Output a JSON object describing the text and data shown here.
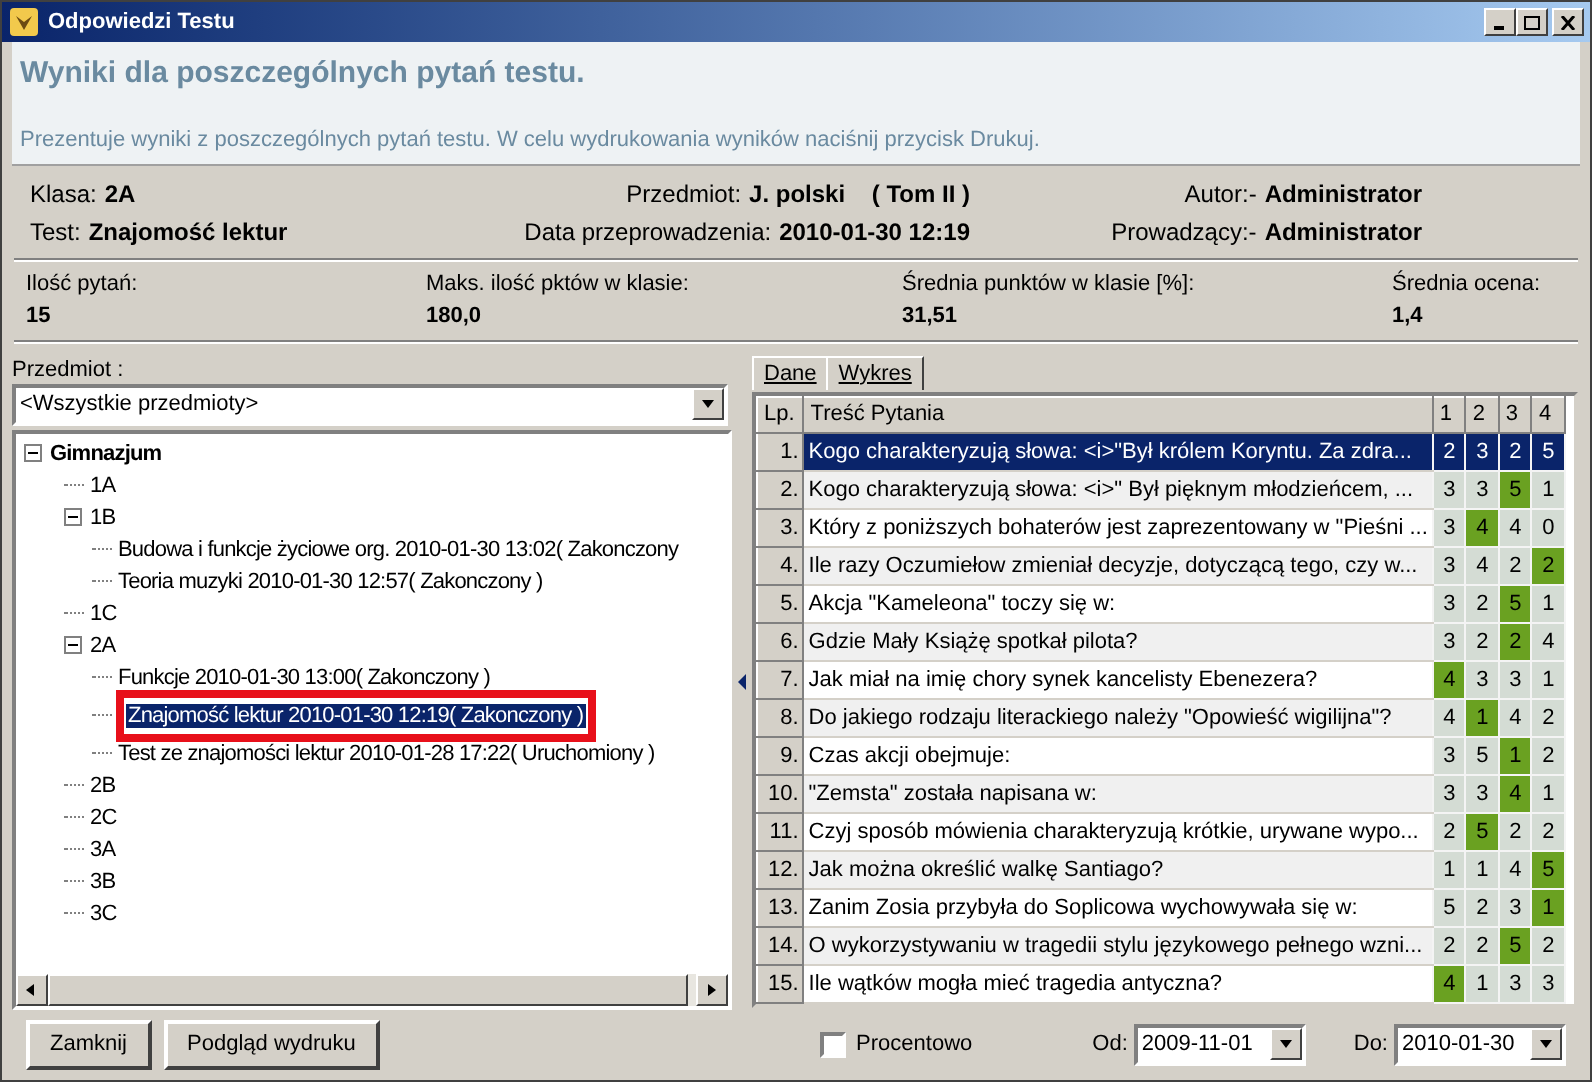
{
  "window": {
    "title": "Odpowiedzi Testu"
  },
  "header": {
    "title": "Wyniki dla poszczególnych pytań testu.",
    "description": "Prezentuje wyniki z poszczególnych pytań testu. W celu wydrukowania wyników naciśnij przycisk Drukuj."
  },
  "info": [
    {
      "label": "Klasa:",
      "value": "2A"
    },
    {
      "label": "Przedmiot:",
      "value": "J. polski    ( Tom II )"
    },
    {
      "label": "Autor:-",
      "value": "Administrator"
    },
    {
      "label": "Test:",
      "value": "Znajomość lektur"
    },
    {
      "label": "Data przeprowadzenia:",
      "value": "2010-01-30 12:19"
    },
    {
      "label": "Prowadzący:-",
      "value": "Administrator"
    }
  ],
  "stats": [
    {
      "label": "Ilość pytań:",
      "value": "15"
    },
    {
      "label": "Maks. ilość pktów w klasie:",
      "value": "180,0"
    },
    {
      "label": "Średnia punktów w klasie [%]:",
      "value": "31,51"
    },
    {
      "label": "Średnia ocena:",
      "value": "1,4"
    }
  ],
  "subject": {
    "label": "Przedmiot :",
    "value": "<Wszystkie przedmioty>"
  },
  "tree": [
    {
      "label": "Gimnazjum",
      "expanded": true,
      "selected": false,
      "children": [
        {
          "label": "1A",
          "selected": false
        },
        {
          "label": "1B",
          "expanded": true,
          "selected": false,
          "children": [
            {
              "label": "Budowa i funkcje życiowe org. 2010-01-30 13:02( Zakonczony",
              "selected": false
            },
            {
              "label": "Teoria muzyki 2010-01-30 12:57( Zakonczony )",
              "selected": false
            }
          ]
        },
        {
          "label": "1C",
          "selected": false
        },
        {
          "label": "2A",
          "expanded": true,
          "selected": false,
          "children": [
            {
              "label": "Funkcje 2010-01-30 13:00( Zakonczony )",
              "selected": false
            },
            {
              "label": "Znajomość lektur 2010-01-30 12:19( Zakonczony )",
              "selected": true,
              "highlighted": true
            },
            {
              "label": "Test ze znajomości lektur 2010-01-28 17:22( Uruchomiony )",
              "selected": false
            }
          ]
        },
        {
          "label": "2B",
          "selected": false
        },
        {
          "label": "2C",
          "selected": false
        },
        {
          "label": "3A",
          "selected": false
        },
        {
          "label": "3B",
          "selected": false
        },
        {
          "label": "3C",
          "selected": false
        }
      ]
    }
  ],
  "tabs": [
    {
      "label": "Dane",
      "selected": true
    },
    {
      "label": "Wykres",
      "selected": false
    }
  ],
  "table": {
    "columns": [
      "Lp.",
      "Treść Pytania",
      "1",
      "2",
      "3",
      "4"
    ],
    "rows": [
      {
        "lp": "1.",
        "question": "Kogo charakteryzują słowa: <i>\"Był królem Koryntu. Za zdra...",
        "selected": true,
        "answers": [
          {
            "value": "2"
          },
          {
            "value": "3"
          },
          {
            "value": "2"
          },
          {
            "value": "5"
          }
        ]
      },
      {
        "lp": "2.",
        "question": "Kogo charakteryzują słowa: <i>\" Był pięknym młodzieńcem, ...",
        "selected": false,
        "answers": [
          {
            "value": "3",
            "correct": false
          },
          {
            "value": "3",
            "correct": false
          },
          {
            "value": "5",
            "correct": true
          },
          {
            "value": "1",
            "correct": false
          }
        ]
      },
      {
        "lp": "3.",
        "question": "Który z poniższych bohaterów jest zaprezentowany w \"Pieśni ...",
        "selected": false,
        "answers": [
          {
            "value": "3",
            "correct": false
          },
          {
            "value": "4",
            "correct": true
          },
          {
            "value": "4",
            "correct": false
          },
          {
            "value": "0",
            "correct": false
          }
        ]
      },
      {
        "lp": "4.",
        "question": "Ile razy Oczumiełow zmieniał decyzje, dotyczącą tego, czy w...",
        "selected": false,
        "answers": [
          {
            "value": "3",
            "correct": false
          },
          {
            "value": "4",
            "correct": false
          },
          {
            "value": "2",
            "correct": false
          },
          {
            "value": "2",
            "correct": true
          }
        ]
      },
      {
        "lp": "5.",
        "question": "Akcja \"Kameleona\" toczy się w:",
        "selected": false,
        "answers": [
          {
            "value": "3",
            "correct": false
          },
          {
            "value": "2",
            "correct": false
          },
          {
            "value": "5",
            "correct": true
          },
          {
            "value": "1",
            "correct": false
          }
        ]
      },
      {
        "lp": "6.",
        "question": "Gdzie Mały Książę spotkał pilota?",
        "selected": false,
        "answers": [
          {
            "value": "3",
            "correct": false
          },
          {
            "value": "2",
            "correct": false
          },
          {
            "value": "2",
            "correct": true
          },
          {
            "value": "4",
            "correct": false
          }
        ]
      },
      {
        "lp": "7.",
        "question": "Jak miał na imię chory synek kancelisty Ebenezera?",
        "selected": false,
        "answers": [
          {
            "value": "4",
            "correct": true
          },
          {
            "value": "3",
            "correct": false
          },
          {
            "value": "3",
            "correct": false
          },
          {
            "value": "1",
            "correct": false
          }
        ]
      },
      {
        "lp": "8.",
        "question": "Do jakiego rodzaju literackiego należy \"Opowieść wigilijna\"?",
        "selected": false,
        "answers": [
          {
            "value": "4",
            "correct": false
          },
          {
            "value": "1",
            "correct": true
          },
          {
            "value": "4",
            "correct": false
          },
          {
            "value": "2",
            "correct": false
          }
        ]
      },
      {
        "lp": "9.",
        "question": "Czas akcji obejmuje:",
        "selected": false,
        "answers": [
          {
            "value": "3",
            "correct": false
          },
          {
            "value": "5",
            "correct": false
          },
          {
            "value": "1",
            "correct": true
          },
          {
            "value": "2",
            "correct": false
          }
        ]
      },
      {
        "lp": "10.",
        "question": "\"Zemsta\" została napisana w:",
        "selected": false,
        "answers": [
          {
            "value": "3",
            "correct": false
          },
          {
            "value": "3",
            "correct": false
          },
          {
            "value": "4",
            "correct": true
          },
          {
            "value": "1",
            "correct": false
          }
        ]
      },
      {
        "lp": "11.",
        "question": "Czyj sposób mówienia charakteryzują krótkie, urywane wypo...",
        "selected": false,
        "answers": [
          {
            "value": "2",
            "correct": false
          },
          {
            "value": "5",
            "correct": true
          },
          {
            "value": "2",
            "correct": false
          },
          {
            "value": "2",
            "correct": false
          }
        ]
      },
      {
        "lp": "12.",
        "question": "Jak można określić walkę Santiago?",
        "selected": false,
        "answers": [
          {
            "value": "1",
            "correct": false
          },
          {
            "value": "1",
            "correct": false
          },
          {
            "value": "4",
            "correct": false
          },
          {
            "value": "5",
            "correct": true
          }
        ]
      },
      {
        "lp": "13.",
        "question": "Zanim Zosia przybyła do Soplicowa wychowywała się w:",
        "selected": false,
        "answers": [
          {
            "value": "5",
            "correct": false
          },
          {
            "value": "2",
            "correct": false
          },
          {
            "value": "3",
            "correct": false
          },
          {
            "value": "1",
            "correct": true
          }
        ]
      },
      {
        "lp": "14.",
        "question": "O wykorzystywaniu w tragedii stylu językowego pełnego wzni...",
        "selected": false,
        "answers": [
          {
            "value": "2",
            "correct": false
          },
          {
            "value": "2",
            "correct": false
          },
          {
            "value": "5",
            "correct": true
          },
          {
            "value": "2",
            "correct": false
          }
        ]
      },
      {
        "lp": "15.",
        "question": "Ile wątków mogła mieć tragedia antyczna?",
        "selected": false,
        "answers": [
          {
            "value": "4",
            "correct": true
          },
          {
            "value": "1",
            "correct": false
          },
          {
            "value": "3",
            "correct": false
          },
          {
            "value": "3",
            "correct": false
          }
        ]
      }
    ]
  },
  "buttons": [
    {
      "label": "Zamknij"
    },
    {
      "label": "Podgląd wydruku"
    }
  ],
  "percent": {
    "label": "Procentowo",
    "checked": false
  },
  "date_from": {
    "label": "Od:",
    "value": "2009-11-01"
  },
  "date_to": {
    "label": "Do:",
    "value": "2010-01-30"
  }
}
